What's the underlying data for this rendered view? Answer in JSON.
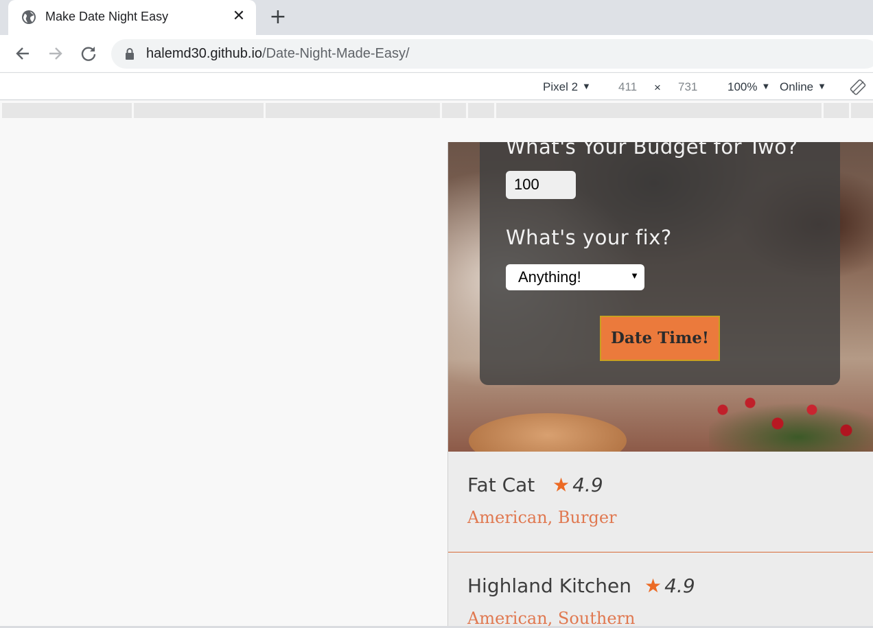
{
  "browser": {
    "tab_title": "Make Date Night Easy",
    "tab_close": "✕",
    "new_tab": "+",
    "url_host": "halemd30.github.io",
    "url_path": "/Date-Night-Made-Easy/"
  },
  "device_toolbar": {
    "device": "Pixel 2",
    "width": "411",
    "times": "×",
    "height": "731",
    "zoom": "100%",
    "network": "Online"
  },
  "form": {
    "budget_question": "What's Your Budget for Two?",
    "budget_value": "100",
    "fix_question": "What's your fix?",
    "fix_selected": "Anything!",
    "submit_label": "Date Time!"
  },
  "results": [
    {
      "name": "Fat Cat",
      "rating": "4.9",
      "cuisine": "American, Burger"
    },
    {
      "name": "Highland Kitchen",
      "rating": "4.9",
      "cuisine": "American, Southern"
    }
  ],
  "colors": {
    "accent": "#eb7a3c",
    "star": "#ec6a24",
    "cuisine": "#e07850"
  }
}
